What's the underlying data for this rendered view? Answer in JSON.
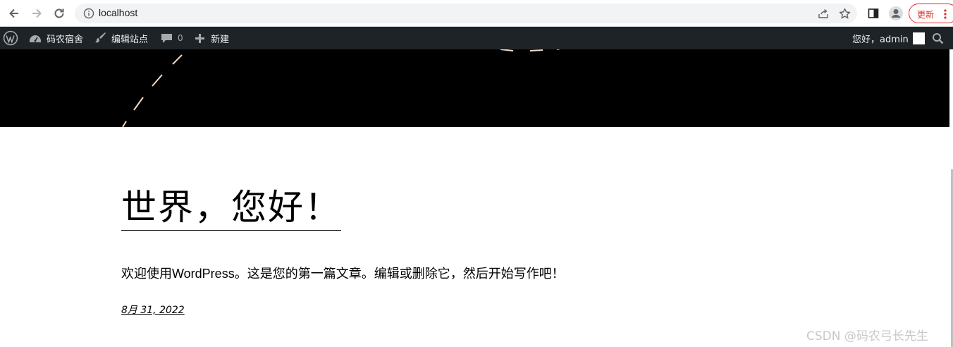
{
  "browser": {
    "url": "localhost",
    "update_label": "更新"
  },
  "admin_bar": {
    "site_name": "码农宿舍",
    "customize_label": "编辑站点",
    "comments_count": "0",
    "new_label": "新建",
    "greeting": "您好，admin"
  },
  "post": {
    "title": "世界，您好！",
    "body": "欢迎使用WordPress。这是您的第一篇文章。编辑或删除它，然后开始写作吧！",
    "date": "8月 31, 2022"
  },
  "watermark": "CSDN @码农弓长先生",
  "colors": {
    "admin_bar_bg": "#1d2327",
    "hero_bg": "#000000",
    "update_red": "#d93025",
    "dash_color": "#f5d9c4"
  }
}
